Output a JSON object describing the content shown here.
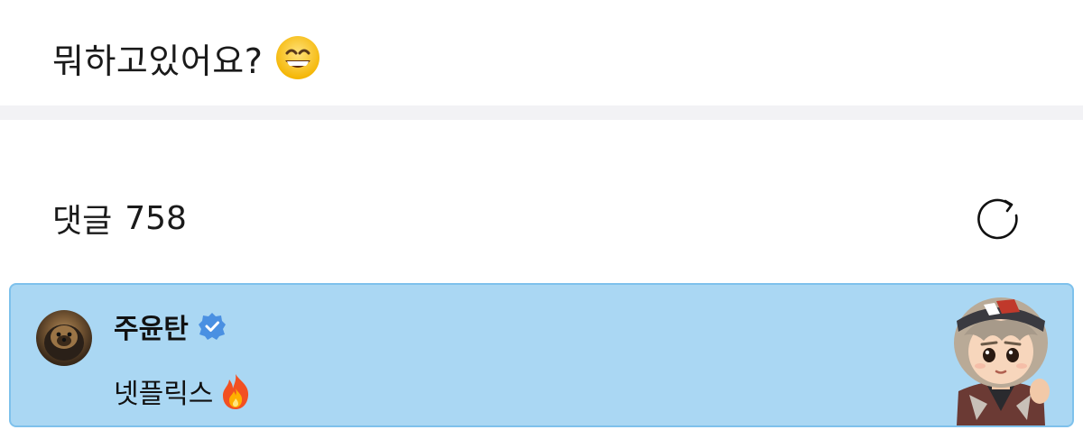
{
  "post": {
    "text": "뭐하고있어요?",
    "emoji": "grinning-face-with-smiling-eyes"
  },
  "comments": {
    "title": "댓글",
    "count": "758",
    "refresh_icon": "refresh-icon"
  },
  "comment": {
    "author": "주윤탄",
    "verified": true,
    "text": "넷플릭스",
    "emoji": "fire",
    "sticker": "character-sticker",
    "highlight_color": "#aad7f3"
  }
}
